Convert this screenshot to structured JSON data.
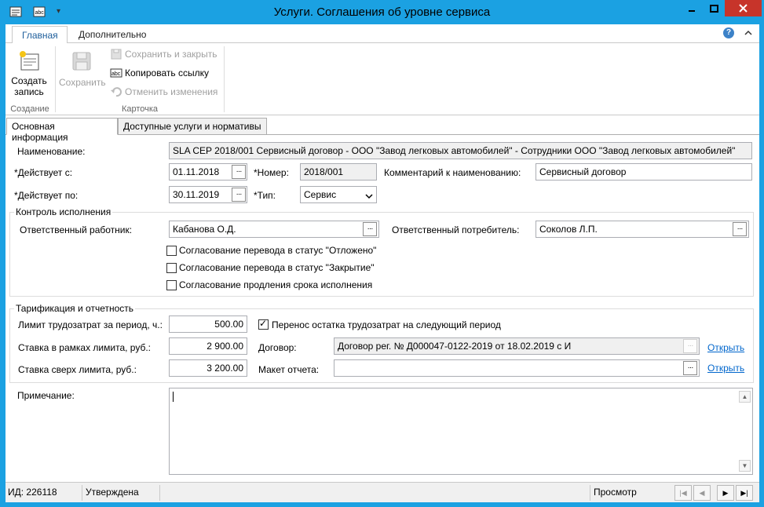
{
  "window": {
    "title": "Услуги. Соглашения об уровне сервиса"
  },
  "ribbon": {
    "tabs": [
      {
        "label": "Главная"
      },
      {
        "label": "Дополнительно"
      }
    ],
    "groups": {
      "create": {
        "label": "Создание",
        "create_button": "Создать запись"
      },
      "card": {
        "label": "Карточка",
        "save": "Сохранить",
        "save_and_close": "Сохранить и закрыть",
        "copy_link": "Копировать ссылку",
        "undo_changes": "Отменить изменения"
      }
    }
  },
  "form_tabs": [
    {
      "label": "Основная информация"
    },
    {
      "label": "Доступные услуги и нормативы"
    }
  ],
  "main": {
    "name_label": "Наименование:",
    "name_value": "SLA CEP 2018/001 Сервисный договор - ООО \"Завод легковых автомобилей\" - Сотрудники ООО \"Завод легковых автомобилей\"",
    "valid_from_label": "*Действует с:",
    "valid_from_value": "01.11.2018",
    "valid_to_label": "*Действует по:",
    "valid_to_value": "30.11.2019",
    "number_label": "*Номер:",
    "number_value": "2018/001",
    "type_label": "*Тип:",
    "type_value": "Сервис",
    "comment_label": "Комментарий к наименованию:",
    "comment_value": "Сервисный договор"
  },
  "control": {
    "group_title": "Контроль исполнения",
    "responsible_worker_label": "Ответственный работник:",
    "responsible_worker_value": "Кабанова О.Д.",
    "responsible_consumer_label": "Ответственный потребитель:",
    "responsible_consumer_value": "Соколов Л.П.",
    "checkboxes": [
      {
        "label": "Согласование перевода в статус \"Отложено\"",
        "checked": false
      },
      {
        "label": "Согласование перевода в статус \"Закрытие\"",
        "checked": false
      },
      {
        "label": "Согласование продления срока исполнения",
        "checked": false
      }
    ]
  },
  "tariff": {
    "group_title": "Тарификация и отчетность",
    "limit_label": "Лимит трудозатрат за период, ч.:",
    "limit_value": "500.00",
    "rate_within_label": "Ставка в рамках лимита, руб.:",
    "rate_within_value": "2 900.00",
    "rate_over_label": "Ставка сверх лимита, руб.:",
    "rate_over_value": "3 200.00",
    "carryover_label": "Перенос остатка трудозатрат на следующий период",
    "carryover_checked": true,
    "contract_label": "Договор:",
    "contract_value": "Договор рег. № Д000047-0122-2019 от 18.02.2019 с И",
    "report_layout_label": "Макет отчета:",
    "report_layout_value": "",
    "open_link": "Открыть"
  },
  "note": {
    "label": "Примечание:",
    "value": ""
  },
  "statusbar": {
    "id_text": "ИД: 226118",
    "status": "Утверждена",
    "mode": "Просмотр"
  },
  "colors": {
    "titlebar": "#1ba1e2",
    "close_button": "#c7342a",
    "link": "#0066cc"
  }
}
